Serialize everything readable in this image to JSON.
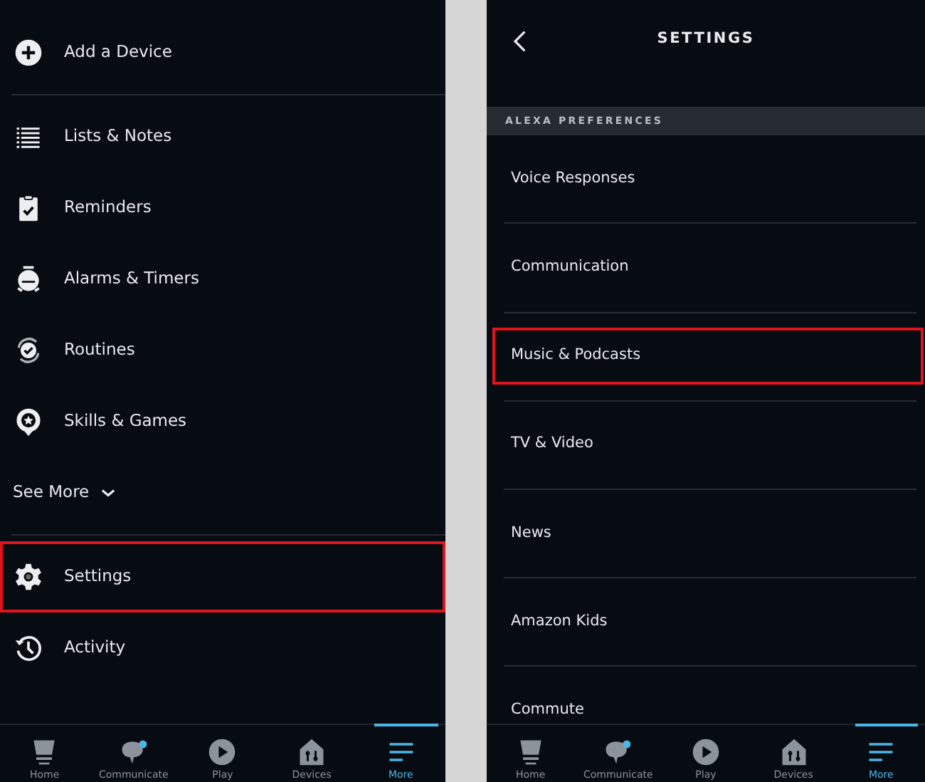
{
  "menu_screen": {
    "groups": [
      [
        {
          "kind": "item",
          "label": "Add a Device",
          "highlighted": false
        }
      ],
      [
        {
          "kind": "item",
          "label": "Lists & Notes",
          "highlighted": false
        },
        {
          "kind": "item",
          "label": "Reminders",
          "highlighted": false
        },
        {
          "kind": "item",
          "label": "Alarms & Timers",
          "highlighted": false
        },
        {
          "kind": "item",
          "label": "Routines",
          "highlighted": false
        },
        {
          "kind": "item",
          "label": "Skills & Games",
          "highlighted": false
        },
        {
          "kind": "expander",
          "label": "See More",
          "highlighted": false
        }
      ],
      [
        {
          "kind": "item",
          "label": "Settings",
          "highlighted": true
        },
        {
          "kind": "item",
          "label": "Activity",
          "highlighted": false
        }
      ]
    ],
    "tab_bar": [
      {
        "label": "Home",
        "selected": false
      },
      {
        "label": "Communicate",
        "selected": false
      },
      {
        "label": "Play",
        "selected": false
      },
      {
        "label": "Devices",
        "selected": false
      },
      {
        "label": "More",
        "selected": true
      }
    ]
  },
  "settings_screen": {
    "title": "SETTINGS",
    "section": "ALEXA PREFERENCES",
    "items": [
      {
        "label": "Voice Responses",
        "highlighted": false
      },
      {
        "label": "Communication",
        "highlighted": false
      },
      {
        "label": "Music & Podcasts",
        "highlighted": true
      },
      {
        "label": "TV & Video",
        "highlighted": false
      },
      {
        "label": "News",
        "highlighted": false
      },
      {
        "label": "Amazon Kids",
        "highlighted": false
      },
      {
        "label": "Commute",
        "highlighted": false
      }
    ],
    "tab_bar": [
      {
        "label": "Home",
        "selected": false
      },
      {
        "label": "Communicate",
        "selected": false
      },
      {
        "label": "Play",
        "selected": false
      },
      {
        "label": "Devices",
        "selected": false
      },
      {
        "label": "More",
        "selected": true
      }
    ]
  }
}
